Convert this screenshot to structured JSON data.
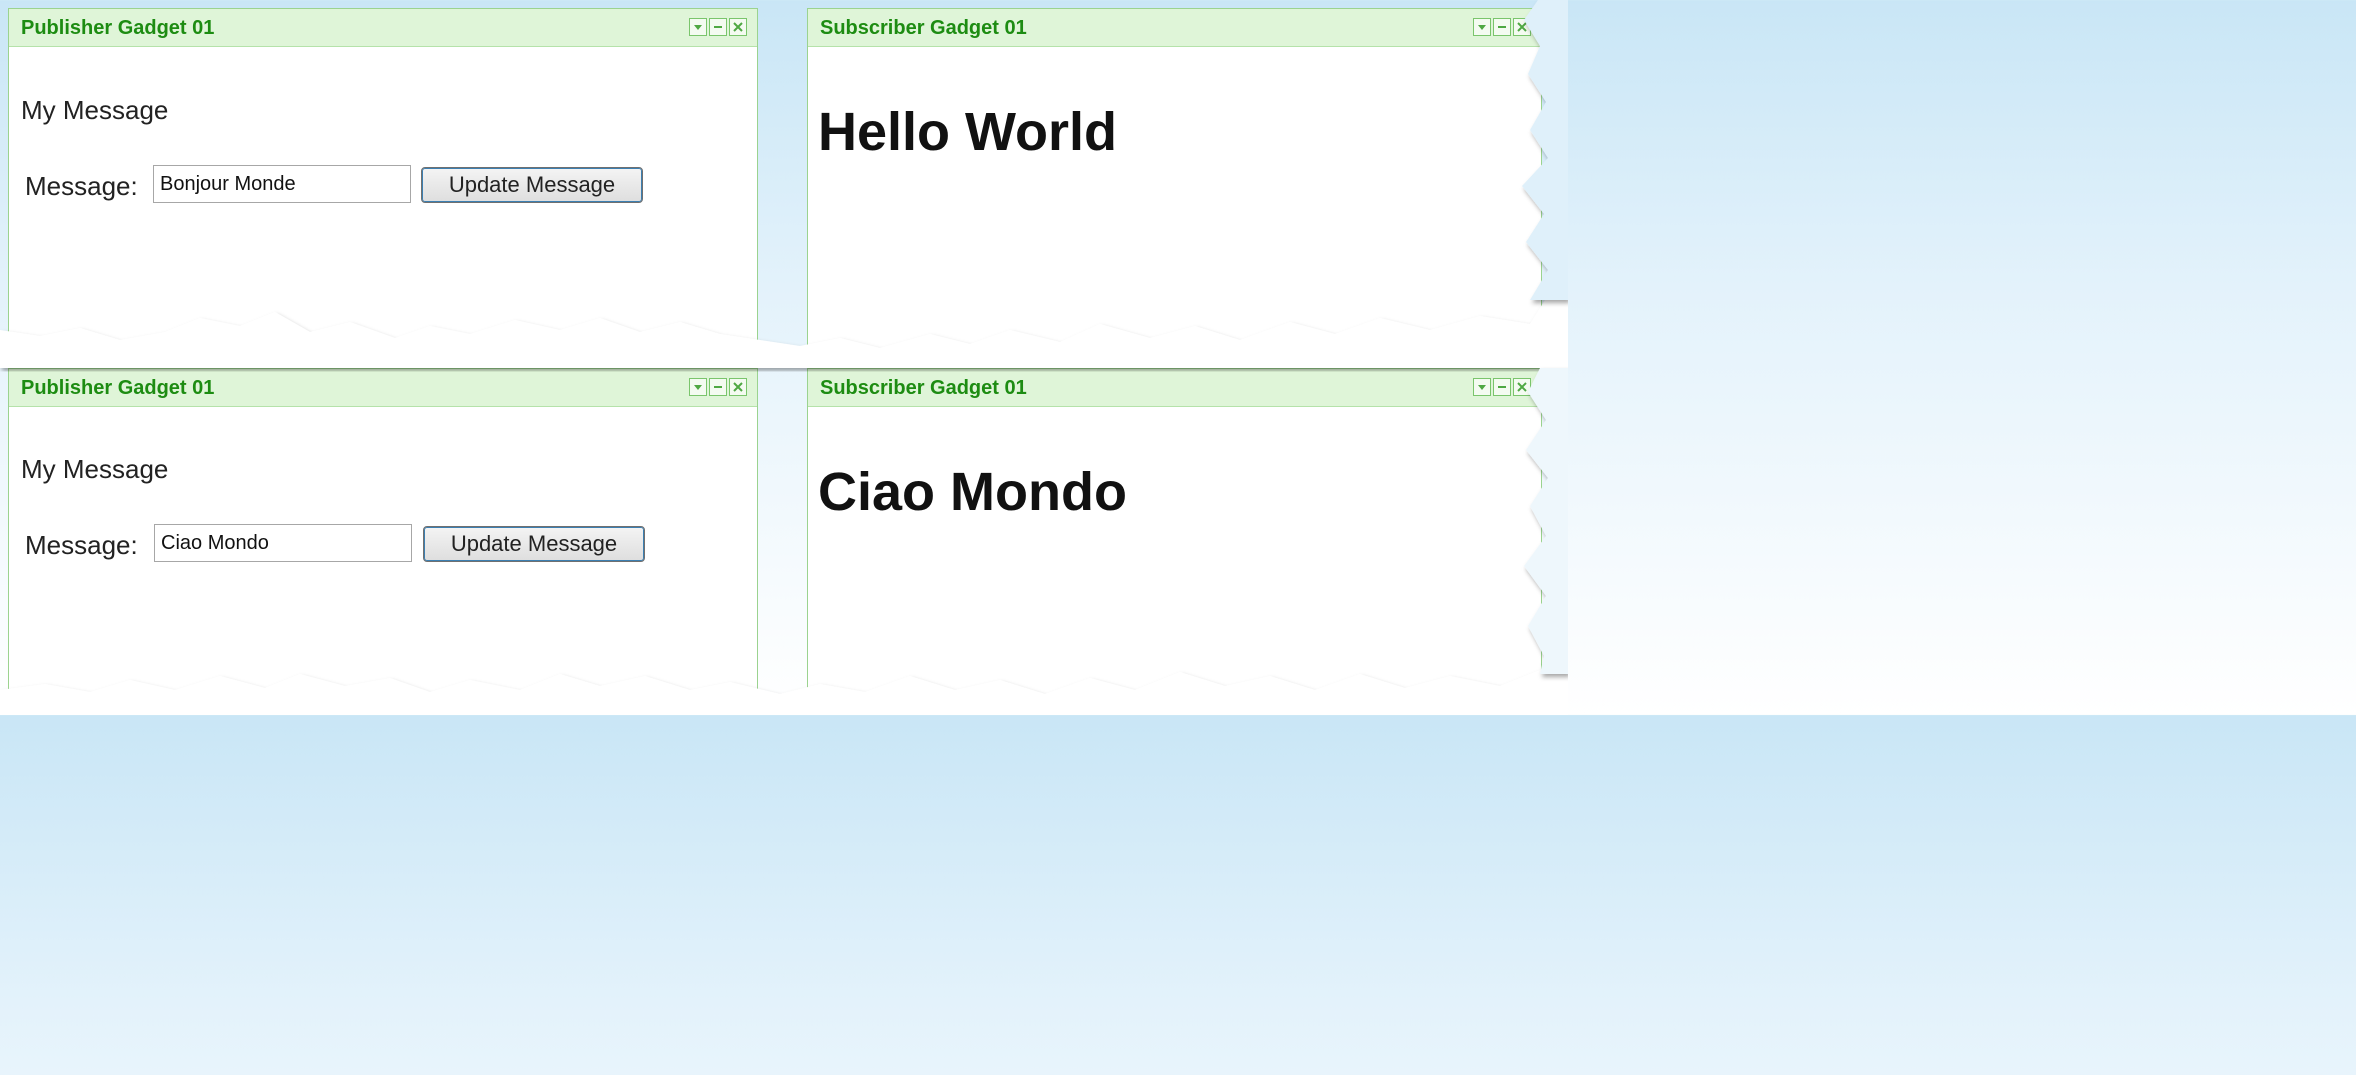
{
  "gadgets": [
    {
      "title": "Publisher Gadget 01",
      "heading": "My Message",
      "message_label": "Message:",
      "message_value": "Bonjour Monde",
      "button_label": "Update Message"
    },
    {
      "title": "Subscriber Gadget 01",
      "display_text": "Hello World"
    },
    {
      "title": "Publisher Gadget 01",
      "heading": "My Message",
      "message_label": "Message:",
      "message_value": "Ciao Mondo",
      "button_label": "Update Message"
    },
    {
      "title": "Subscriber Gadget 01",
      "display_text": "Ciao Mondo"
    }
  ],
  "window_controls": [
    "dropdown-icon",
    "minimize-icon",
    "close-icon"
  ],
  "colors": {
    "title_text": "#1d8c12",
    "title_bar_bg": "#dff5d8",
    "border": "#9bd38f",
    "background_blue": "#c9e6f6"
  }
}
